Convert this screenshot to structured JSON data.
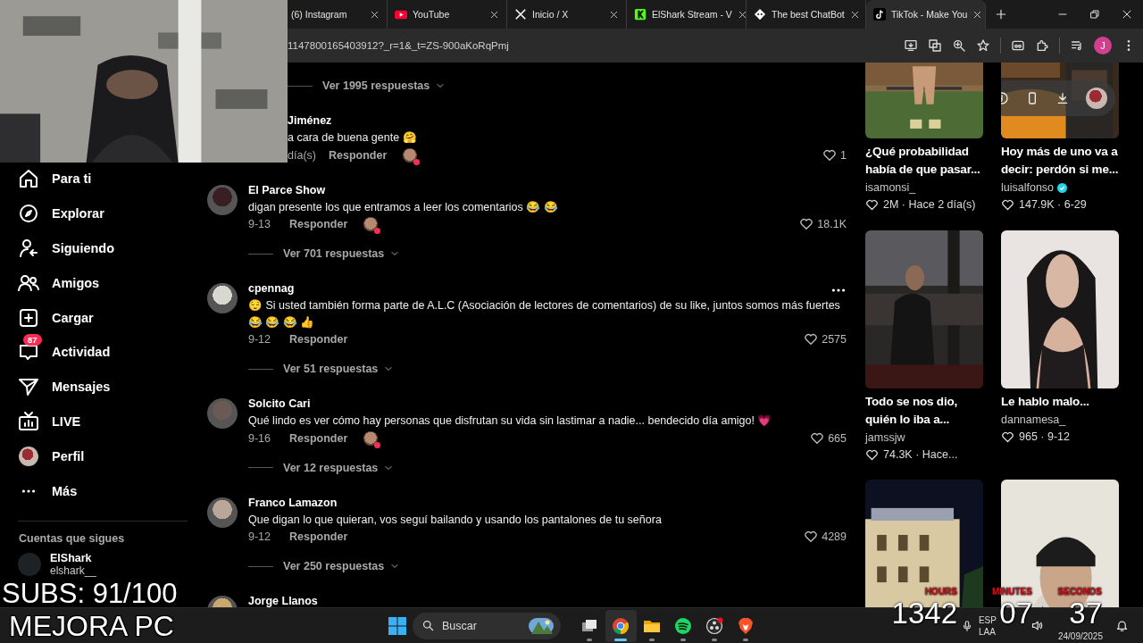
{
  "browser": {
    "tabs": [
      {
        "title": "(6) Instagram",
        "kind": "plain",
        "selected": false
      },
      {
        "title": "YouTube",
        "kind": "youtube",
        "selected": false
      },
      {
        "title": "Inicio / X",
        "kind": "x",
        "selected": false
      },
      {
        "title": "ElShark Stream - V",
        "kind": "kick",
        "selected": false
      },
      {
        "title": "The best ChatBot",
        "kind": "chatbot",
        "selected": false
      },
      {
        "title": "TikTok - Make You",
        "kind": "tiktok",
        "selected": true
      }
    ],
    "address": "1147800165403912?_r=1&_t=ZS-900aKoRqPmj",
    "profile_initial": "J"
  },
  "sidebar": {
    "items": [
      {
        "label": "Para ti",
        "kind": "home"
      },
      {
        "label": "Explorar",
        "kind": "explore"
      },
      {
        "label": "Siguiendo",
        "kind": "following"
      },
      {
        "label": "Amigos",
        "kind": "friends"
      },
      {
        "label": "Cargar",
        "kind": "upload"
      },
      {
        "label": "Actividad",
        "kind": "activity",
        "badge": "87"
      },
      {
        "label": "Mensajes",
        "kind": "messages"
      },
      {
        "label": "LIVE",
        "kind": "live"
      },
      {
        "label": "Perfil",
        "kind": "profile"
      },
      {
        "label": "Más",
        "kind": "more"
      }
    ],
    "following_title": "Cuentas que sigues",
    "accounts": [
      {
        "name": "ElShark",
        "handle": "elshark__"
      }
    ]
  },
  "comments": {
    "top_fragment": {
      "replies": "Ver 1995 respuestas",
      "name": "Jiménez",
      "text": "a cara de buena gente 🤗",
      "date": "día(s)",
      "reply": "Responder",
      "reacted": true,
      "likes": "1"
    },
    "items": [
      {
        "name": "El Parce Show",
        "text": "digan presente los que entramos a leer los comentarios 😂 😂",
        "date": "9-13",
        "reply": "Responder",
        "reacted": true,
        "likes": "18.1K",
        "more": false,
        "replies": "Ver 701 respuestas"
      },
      {
        "name": "cpennag",
        "text": "😌 Si usted también forma parte de A.L.C (Asociación de lectores de comentarios) de su like, juntos somos más fuertes😂 😂 😂 👍",
        "date": "9-12",
        "reply": "Responder",
        "reacted": false,
        "likes": "2575",
        "more": true,
        "replies": "Ver 51 respuestas"
      },
      {
        "name": "Solcito Cari",
        "text": "Qué lindo es ver cómo hay personas que disfrutan su vida sin lastimar a nadie... bendecido día amigo! 💗",
        "date": "9-16",
        "reply": "Responder",
        "reacted": true,
        "likes": "665",
        "more": false,
        "replies": "Ver 12 respuestas"
      },
      {
        "name": "Franco Lamazon",
        "text": "Que digan lo que quieran, vos seguí bailando y usando los pantalones de tu señora",
        "date": "9-12",
        "reply": "Responder",
        "reacted": false,
        "likes": "4289",
        "more": false,
        "replies": "Ver 250 respuestas"
      },
      {
        "name": "Jorge Llanos"
      }
    ]
  },
  "videos": [
    {
      "title": "¿Qué probabilidad había de que pasar...",
      "author": "isamonsi_",
      "verified": false,
      "stats": "2M · Hace 2 día(s)"
    },
    {
      "title": "Hoy más de uno va a decir: perdón si me...",
      "author": "luisalfonso",
      "verified": true,
      "stats": "147.9K · 6-29",
      "tools": true
    },
    {
      "title": "Todo se nos dio, quién lo iba a...",
      "author": "jamssjw",
      "verified": false,
      "stats": "74.3K · Hace..."
    },
    {
      "title": "Le hablo malo...",
      "author": "dannamesa_",
      "verified": false,
      "stats": "965 · 9-12"
    },
    {
      "kind": "picture"
    },
    {
      "kind": "picture"
    }
  ],
  "taskbar": {
    "search_placeholder": "Buscar",
    "apps": [
      {
        "kind": "task-view",
        "selected": false
      },
      {
        "kind": "chrome",
        "selected": true
      },
      {
        "kind": "files",
        "selected": false
      },
      {
        "kind": "spotify",
        "selected": false
      },
      {
        "kind": "obs",
        "selected": false
      },
      {
        "kind": "brave",
        "selected": false
      }
    ],
    "lang": "ESP",
    "layout": "LAA",
    "date": "24/09/2025"
  },
  "overlay": {
    "webcam": {
      "kind": "picture"
    },
    "subs": "SUBS: 91/100",
    "banner": "MEJORA PC",
    "timer": [
      {
        "label": "HOURS",
        "value": "1342"
      },
      {
        "label": "MINUTES",
        "value": "07"
      },
      {
        "label": "SECONDS",
        "value": "37"
      }
    ]
  }
}
